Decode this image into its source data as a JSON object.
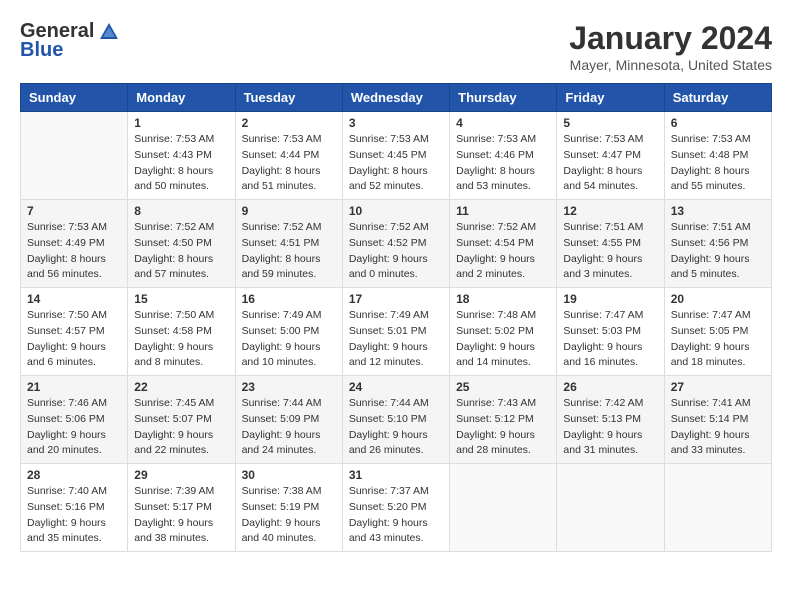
{
  "header": {
    "logo_general": "General",
    "logo_blue": "Blue",
    "month_title": "January 2024",
    "location": "Mayer, Minnesota, United States"
  },
  "days_of_week": [
    "Sunday",
    "Monday",
    "Tuesday",
    "Wednesday",
    "Thursday",
    "Friday",
    "Saturday"
  ],
  "weeks": [
    [
      {
        "day": "",
        "sunrise": "",
        "sunset": "",
        "daylight": ""
      },
      {
        "day": "1",
        "sunrise": "Sunrise: 7:53 AM",
        "sunset": "Sunset: 4:43 PM",
        "daylight": "Daylight: 8 hours and 50 minutes."
      },
      {
        "day": "2",
        "sunrise": "Sunrise: 7:53 AM",
        "sunset": "Sunset: 4:44 PM",
        "daylight": "Daylight: 8 hours and 51 minutes."
      },
      {
        "day": "3",
        "sunrise": "Sunrise: 7:53 AM",
        "sunset": "Sunset: 4:45 PM",
        "daylight": "Daylight: 8 hours and 52 minutes."
      },
      {
        "day": "4",
        "sunrise": "Sunrise: 7:53 AM",
        "sunset": "Sunset: 4:46 PM",
        "daylight": "Daylight: 8 hours and 53 minutes."
      },
      {
        "day": "5",
        "sunrise": "Sunrise: 7:53 AM",
        "sunset": "Sunset: 4:47 PM",
        "daylight": "Daylight: 8 hours and 54 minutes."
      },
      {
        "day": "6",
        "sunrise": "Sunrise: 7:53 AM",
        "sunset": "Sunset: 4:48 PM",
        "daylight": "Daylight: 8 hours and 55 minutes."
      }
    ],
    [
      {
        "day": "7",
        "sunrise": "Sunrise: 7:53 AM",
        "sunset": "Sunset: 4:49 PM",
        "daylight": "Daylight: 8 hours and 56 minutes."
      },
      {
        "day": "8",
        "sunrise": "Sunrise: 7:52 AM",
        "sunset": "Sunset: 4:50 PM",
        "daylight": "Daylight: 8 hours and 57 minutes."
      },
      {
        "day": "9",
        "sunrise": "Sunrise: 7:52 AM",
        "sunset": "Sunset: 4:51 PM",
        "daylight": "Daylight: 8 hours and 59 minutes."
      },
      {
        "day": "10",
        "sunrise": "Sunrise: 7:52 AM",
        "sunset": "Sunset: 4:52 PM",
        "daylight": "Daylight: 9 hours and 0 minutes."
      },
      {
        "day": "11",
        "sunrise": "Sunrise: 7:52 AM",
        "sunset": "Sunset: 4:54 PM",
        "daylight": "Daylight: 9 hours and 2 minutes."
      },
      {
        "day": "12",
        "sunrise": "Sunrise: 7:51 AM",
        "sunset": "Sunset: 4:55 PM",
        "daylight": "Daylight: 9 hours and 3 minutes."
      },
      {
        "day": "13",
        "sunrise": "Sunrise: 7:51 AM",
        "sunset": "Sunset: 4:56 PM",
        "daylight": "Daylight: 9 hours and 5 minutes."
      }
    ],
    [
      {
        "day": "14",
        "sunrise": "Sunrise: 7:50 AM",
        "sunset": "Sunset: 4:57 PM",
        "daylight": "Daylight: 9 hours and 6 minutes."
      },
      {
        "day": "15",
        "sunrise": "Sunrise: 7:50 AM",
        "sunset": "Sunset: 4:58 PM",
        "daylight": "Daylight: 9 hours and 8 minutes."
      },
      {
        "day": "16",
        "sunrise": "Sunrise: 7:49 AM",
        "sunset": "Sunset: 5:00 PM",
        "daylight": "Daylight: 9 hours and 10 minutes."
      },
      {
        "day": "17",
        "sunrise": "Sunrise: 7:49 AM",
        "sunset": "Sunset: 5:01 PM",
        "daylight": "Daylight: 9 hours and 12 minutes."
      },
      {
        "day": "18",
        "sunrise": "Sunrise: 7:48 AM",
        "sunset": "Sunset: 5:02 PM",
        "daylight": "Daylight: 9 hours and 14 minutes."
      },
      {
        "day": "19",
        "sunrise": "Sunrise: 7:47 AM",
        "sunset": "Sunset: 5:03 PM",
        "daylight": "Daylight: 9 hours and 16 minutes."
      },
      {
        "day": "20",
        "sunrise": "Sunrise: 7:47 AM",
        "sunset": "Sunset: 5:05 PM",
        "daylight": "Daylight: 9 hours and 18 minutes."
      }
    ],
    [
      {
        "day": "21",
        "sunrise": "Sunrise: 7:46 AM",
        "sunset": "Sunset: 5:06 PM",
        "daylight": "Daylight: 9 hours and 20 minutes."
      },
      {
        "day": "22",
        "sunrise": "Sunrise: 7:45 AM",
        "sunset": "Sunset: 5:07 PM",
        "daylight": "Daylight: 9 hours and 22 minutes."
      },
      {
        "day": "23",
        "sunrise": "Sunrise: 7:44 AM",
        "sunset": "Sunset: 5:09 PM",
        "daylight": "Daylight: 9 hours and 24 minutes."
      },
      {
        "day": "24",
        "sunrise": "Sunrise: 7:44 AM",
        "sunset": "Sunset: 5:10 PM",
        "daylight": "Daylight: 9 hours and 26 minutes."
      },
      {
        "day": "25",
        "sunrise": "Sunrise: 7:43 AM",
        "sunset": "Sunset: 5:12 PM",
        "daylight": "Daylight: 9 hours and 28 minutes."
      },
      {
        "day": "26",
        "sunrise": "Sunrise: 7:42 AM",
        "sunset": "Sunset: 5:13 PM",
        "daylight": "Daylight: 9 hours and 31 minutes."
      },
      {
        "day": "27",
        "sunrise": "Sunrise: 7:41 AM",
        "sunset": "Sunset: 5:14 PM",
        "daylight": "Daylight: 9 hours and 33 minutes."
      }
    ],
    [
      {
        "day": "28",
        "sunrise": "Sunrise: 7:40 AM",
        "sunset": "Sunset: 5:16 PM",
        "daylight": "Daylight: 9 hours and 35 minutes."
      },
      {
        "day": "29",
        "sunrise": "Sunrise: 7:39 AM",
        "sunset": "Sunset: 5:17 PM",
        "daylight": "Daylight: 9 hours and 38 minutes."
      },
      {
        "day": "30",
        "sunrise": "Sunrise: 7:38 AM",
        "sunset": "Sunset: 5:19 PM",
        "daylight": "Daylight: 9 hours and 40 minutes."
      },
      {
        "day": "31",
        "sunrise": "Sunrise: 7:37 AM",
        "sunset": "Sunset: 5:20 PM",
        "daylight": "Daylight: 9 hours and 43 minutes."
      },
      {
        "day": "",
        "sunrise": "",
        "sunset": "",
        "daylight": ""
      },
      {
        "day": "",
        "sunrise": "",
        "sunset": "",
        "daylight": ""
      },
      {
        "day": "",
        "sunrise": "",
        "sunset": "",
        "daylight": ""
      }
    ]
  ]
}
